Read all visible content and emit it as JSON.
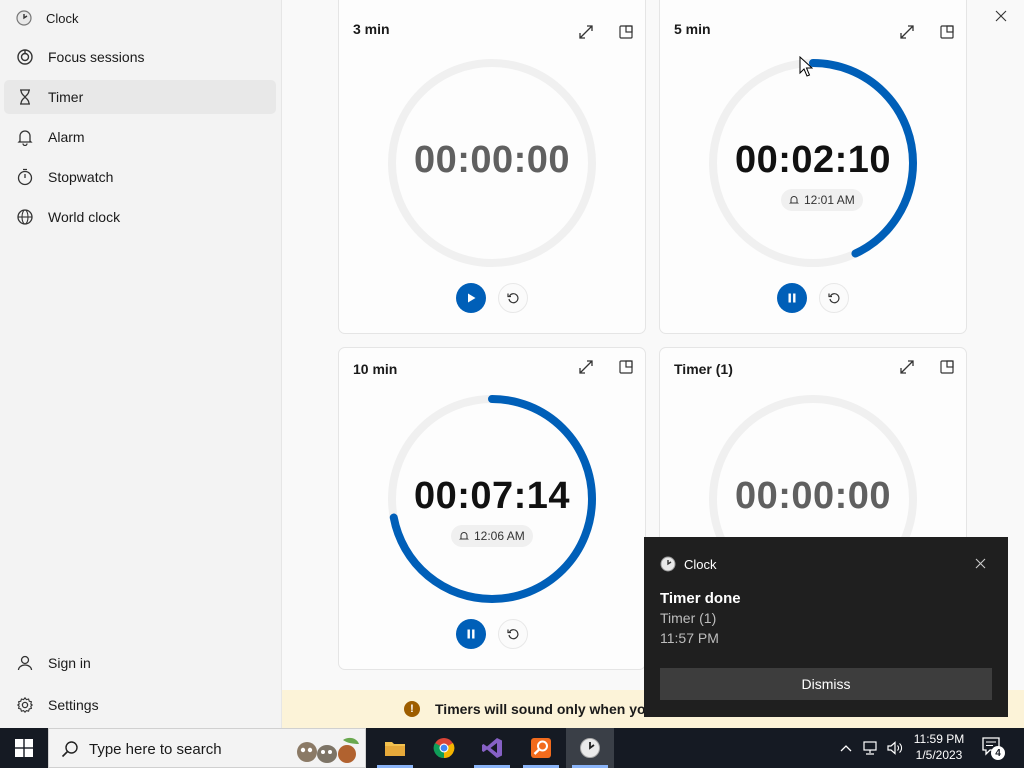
{
  "app": {
    "title": "Clock"
  },
  "sidebar": {
    "items": [
      {
        "label": "Focus sessions",
        "icon": "focus-icon"
      },
      {
        "label": "Timer",
        "icon": "hourglass-icon"
      },
      {
        "label": "Alarm",
        "icon": "bell-icon"
      },
      {
        "label": "Stopwatch",
        "icon": "stopwatch-icon"
      },
      {
        "label": "World clock",
        "icon": "globe-icon"
      }
    ],
    "bottom": [
      {
        "label": "Sign in",
        "icon": "person-icon"
      },
      {
        "label": "Settings",
        "icon": "gear-icon"
      }
    ],
    "selected": "Timer"
  },
  "timers": [
    {
      "name": "3 min",
      "time": "00:00:00",
      "alarm": "",
      "state": "idle",
      "progress": 0
    },
    {
      "name": "5 min",
      "time": "00:02:10",
      "alarm": "12:01 AM",
      "state": "running",
      "progress": 0.43
    },
    {
      "name": "10 min",
      "time": "00:07:14",
      "alarm": "12:06 AM",
      "state": "running",
      "progress": 0.72
    },
    {
      "name": "Timer (1)",
      "time": "00:00:00",
      "alarm": "",
      "state": "idle",
      "progress": 0
    }
  ],
  "banner": {
    "text": "Timers will sound only when you"
  },
  "toast": {
    "app": "Clock",
    "title": "Timer done",
    "subtitle": "Timer (1)",
    "time": "11:57 PM",
    "button": "Dismiss"
  },
  "taskbar": {
    "search_placeholder": "Type here to search",
    "clock_time": "11:59 PM",
    "clock_date": "1/5/2023",
    "notification_count": "4"
  },
  "colors": {
    "accent": "#005fb8",
    "ring_track": "#f0f0f0",
    "banner": "#fcf3d8",
    "toast": "#1f1f1f"
  }
}
